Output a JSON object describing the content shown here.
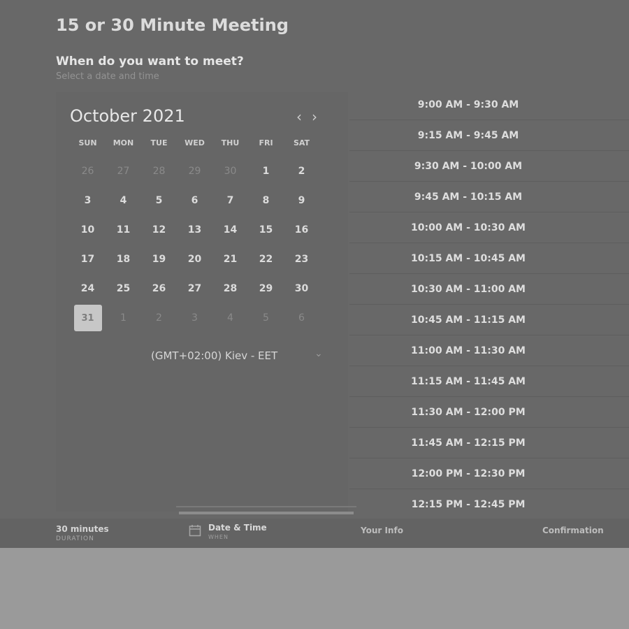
{
  "page": {
    "title": "15 or 30 Minute Meeting",
    "question": "When do you want to meet?",
    "subtitle": "Select a date and time"
  },
  "calendar": {
    "month_label": "October 2021",
    "prev_icon": "chevron-left-icon",
    "next_icon": "chevron-right-icon",
    "weekdays": [
      "SUN",
      "MON",
      "TUE",
      "WED",
      "THU",
      "FRI",
      "SAT"
    ],
    "days": [
      {
        "label": "26",
        "faded": true
      },
      {
        "label": "27",
        "faded": true
      },
      {
        "label": "28",
        "faded": true
      },
      {
        "label": "29",
        "faded": true
      },
      {
        "label": "30",
        "faded": true
      },
      {
        "label": "1",
        "faded": false
      },
      {
        "label": "2",
        "faded": false
      },
      {
        "label": "3",
        "faded": false
      },
      {
        "label": "4",
        "faded": false
      },
      {
        "label": "5",
        "faded": false
      },
      {
        "label": "6",
        "faded": false
      },
      {
        "label": "7",
        "faded": false
      },
      {
        "label": "8",
        "faded": false
      },
      {
        "label": "9",
        "faded": false
      },
      {
        "label": "10",
        "faded": false
      },
      {
        "label": "11",
        "faded": false
      },
      {
        "label": "12",
        "faded": false
      },
      {
        "label": "13",
        "faded": false
      },
      {
        "label": "14",
        "faded": false
      },
      {
        "label": "15",
        "faded": false
      },
      {
        "label": "16",
        "faded": false
      },
      {
        "label": "17",
        "faded": false
      },
      {
        "label": "18",
        "faded": false
      },
      {
        "label": "19",
        "faded": false
      },
      {
        "label": "20",
        "faded": false
      },
      {
        "label": "21",
        "faded": false
      },
      {
        "label": "22",
        "faded": false
      },
      {
        "label": "23",
        "faded": false
      },
      {
        "label": "24",
        "faded": false
      },
      {
        "label": "25",
        "faded": false
      },
      {
        "label": "26",
        "faded": false
      },
      {
        "label": "27",
        "faded": false
      },
      {
        "label": "28",
        "faded": false
      },
      {
        "label": "29",
        "faded": false
      },
      {
        "label": "30",
        "faded": false
      },
      {
        "label": "31",
        "faded": false,
        "selected": true
      },
      {
        "label": "1",
        "faded": true
      },
      {
        "label": "2",
        "faded": true
      },
      {
        "label": "3",
        "faded": true
      },
      {
        "label": "4",
        "faded": true
      },
      {
        "label": "5",
        "faded": true
      },
      {
        "label": "6",
        "faded": true
      }
    ],
    "timezone": "(GMT+02:00) Kiev - EET",
    "timezone_icon": "chevron-down-icon"
  },
  "time_slots": [
    "9:00 AM - 9:30 AM",
    "9:15 AM - 9:45 AM",
    "9:30 AM - 10:00 AM",
    "9:45 AM - 10:15 AM",
    "10:00 AM - 10:30 AM",
    "10:15 AM - 10:45 AM",
    "10:30 AM - 11:00 AM",
    "10:45 AM - 11:15 AM",
    "11:00 AM - 11:30 AM",
    "11:15 AM - 11:45 AM",
    "11:30 AM - 12:00 PM",
    "11:45 AM - 12:15 PM",
    "12:00 PM - 12:30 PM",
    "12:15 PM - 12:45 PM"
  ],
  "footer": {
    "duration": "30 minutes",
    "duration_sub": "DURATION",
    "step_label": "Date & Time",
    "step_sub": "WHEN",
    "step_icon": "calendar-icon",
    "step2_label": "Your Info",
    "step3_label": "Confirmation"
  },
  "progress": {
    "fraction": 1.0
  },
  "colors": {
    "background": "#686868",
    "selected_day": "#c7c7c7",
    "text": "#e4e4e4"
  }
}
